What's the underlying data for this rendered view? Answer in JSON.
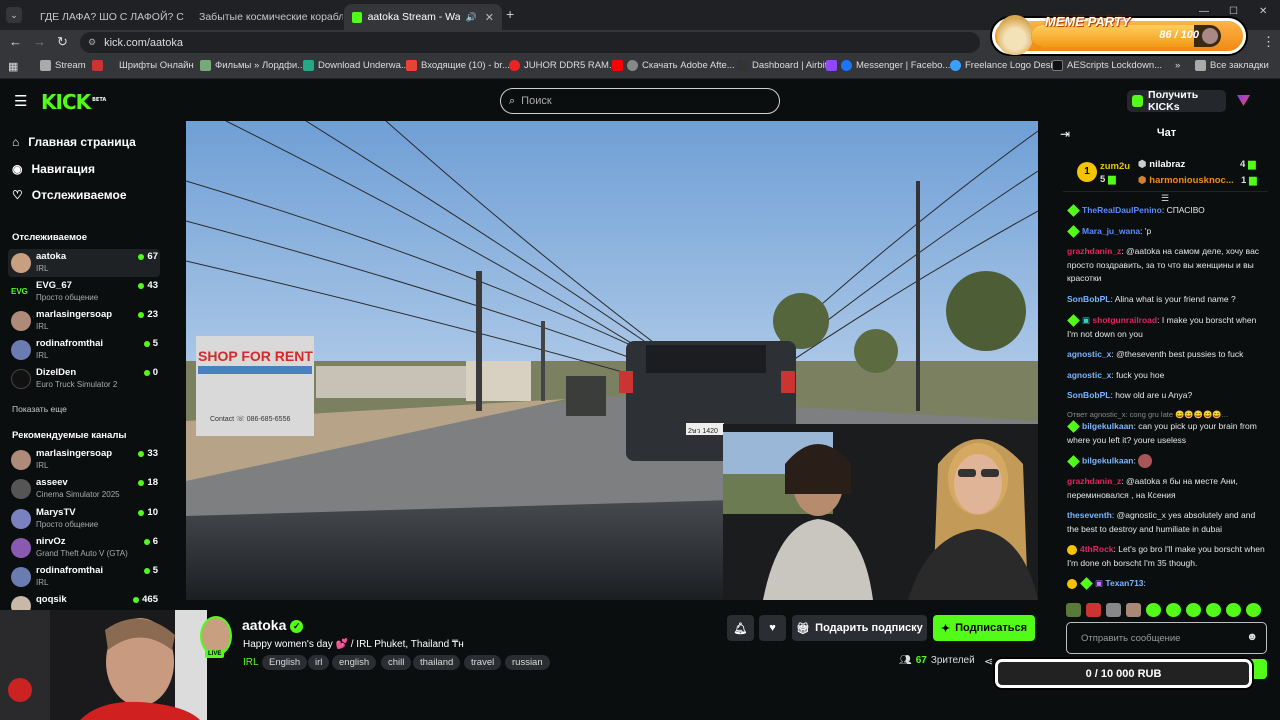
{
  "browser": {
    "tabs": [
      {
        "title": "ГДЕ ЛАФА? ШО С ЛАФОЙ? СУ"
      },
      {
        "title": "Забытые космические корабл"
      },
      {
        "title": "aatoka Stream - Watch Live"
      }
    ],
    "url": "kick.com/aatoka",
    "bookmarks": [
      "Stream",
      "Шрифты Онлайн",
      "Фильмы » Лордфи...",
      "Download Underwa...",
      "Входящие (10) - br...",
      "JUHOR DDR5 RAM...",
      "Скачать Adobe Afte...",
      "Dashboard | Airbit",
      "Messenger | Facebo...",
      "Freelance Logo Desi...",
      "AEScripts Lockdown..."
    ],
    "all_bookmarks": "Все закладки"
  },
  "meme_party": {
    "label": "MEME PARTY",
    "progress": "86 / 100",
    "fraction": 0.86
  },
  "kick": {
    "logo": "KICK",
    "beta": "BETA",
    "search_placeholder": "Поиск",
    "get_kicks": "Получить KICKs"
  },
  "sidebar": {
    "nav": [
      "Главная страница",
      "Навигация",
      "Отслеживаемое"
    ],
    "following_title": "Отслеживаемое",
    "following": [
      {
        "name": "aatoka",
        "category": "IRL",
        "viewers": "67"
      },
      {
        "name": "EVG_67",
        "category": "Просто общение",
        "viewers": "43"
      },
      {
        "name": "marlasingersoap",
        "category": "IRL",
        "viewers": "23"
      },
      {
        "name": "rodinafromthai",
        "category": "IRL",
        "viewers": "5"
      },
      {
        "name": "DizelDen",
        "category": "Euro Truck Simulator 2",
        "viewers": "0"
      }
    ],
    "show_more": "Показать еще",
    "recommended_title": "Рекомендуемые каналы",
    "recommended": [
      {
        "name": "marlasingersoap",
        "category": "IRL",
        "viewers": "33"
      },
      {
        "name": "asseev",
        "category": "Cinema Simulator 2025",
        "viewers": "18"
      },
      {
        "name": "MarysTV",
        "category": "Просто общение",
        "viewers": "10"
      },
      {
        "name": "nirvOz",
        "category": "Grand Theft Auto V (GTA)",
        "viewers": "6"
      },
      {
        "name": "rodinafromthai",
        "category": "IRL",
        "viewers": "5"
      },
      {
        "name": "qoqsik",
        "category": "",
        "viewers": "465"
      }
    ]
  },
  "video": {
    "sign_text": "SHOP FOR RENT",
    "sign_phone": "Contact ☏ 086-685-6556",
    "plate": "2ษว 1420"
  },
  "stream": {
    "name": "aatoka",
    "live": "LIVE",
    "title": "Happy women's day 💕 / IRL Phuket, Thailand ₸н",
    "category": "IRL",
    "tags": [
      "English",
      "irl",
      "english",
      "chill",
      "thailand",
      "travel",
      "russian"
    ],
    "gift_sub": "Подарить подписку",
    "subscribe": "Подписаться",
    "viewers": "67",
    "viewers_label": "Зрителей"
  },
  "chat": {
    "title": "Чат",
    "leaders": [
      {
        "rank": "1",
        "name": "zum2u",
        "count": "5"
      },
      {
        "name": "nilabraz",
        "count": "4"
      },
      {
        "name": "harmoniousknoc...",
        "count": "1"
      }
    ],
    "messages": [
      {
        "user": "TheRealDaulPenino",
        "text": "СПАСІВО",
        "color": "#5b8cff"
      },
      {
        "user": "Mara_ju_wana",
        "text": "'p",
        "color": "#5b8cff"
      },
      {
        "user": "grazhdanin_z",
        "text": "@aatoka на самом деле, хочу вас просто поздравить, за то что вы женщины и вы красотки",
        "color": "#e0245e"
      },
      {
        "user": "SonBobPL",
        "text": "Alina what is your friend name ?",
        "color": "#7ab6ff"
      },
      {
        "user": "shotgunrailroad",
        "text": "I make you borscht when I'm not down on you",
        "color": "#e0245e"
      },
      {
        "user": "agnostic_x",
        "text": "@theseventh best pussies to fuck",
        "color": "#7ab6ff"
      },
      {
        "user": "agnostic_x",
        "text": "fuck you hoe",
        "color": "#7ab6ff"
      },
      {
        "user": "SonBobPL",
        "text": "how old are u Anya?",
        "color": "#7ab6ff"
      },
      {
        "user": "bilgekulkaan",
        "text": "can you pick up your brain from where you left it? youre useless",
        "color": "#7ab6ff",
        "reply": "Ответ agnostic_x: cong gru late 😄😄😄😄😄..."
      },
      {
        "user": "bilgekulkaan",
        "text": "",
        "color": "#7ab6ff"
      },
      {
        "user": "grazhdanin_z",
        "text": "@aatoka я бы на месте Ани, переминовался , на Ксения",
        "color": "#e0245e"
      },
      {
        "user": "theseventh",
        "text": "@agnostic_x yes absolutely and and the best to destroy and humiliate in dubai",
        "color": "#7ab6ff"
      },
      {
        "user": "4thRock",
        "text": "Let's go bro I'll make you borscht when I'm done oh borscht I'm 35 though.",
        "color": "#e0245e"
      },
      {
        "user": "Texan713",
        "text": "",
        "color": "#7ab6ff"
      }
    ],
    "input_placeholder": "Отправить сообщение",
    "rub": "0 / 10 000 RUB"
  }
}
